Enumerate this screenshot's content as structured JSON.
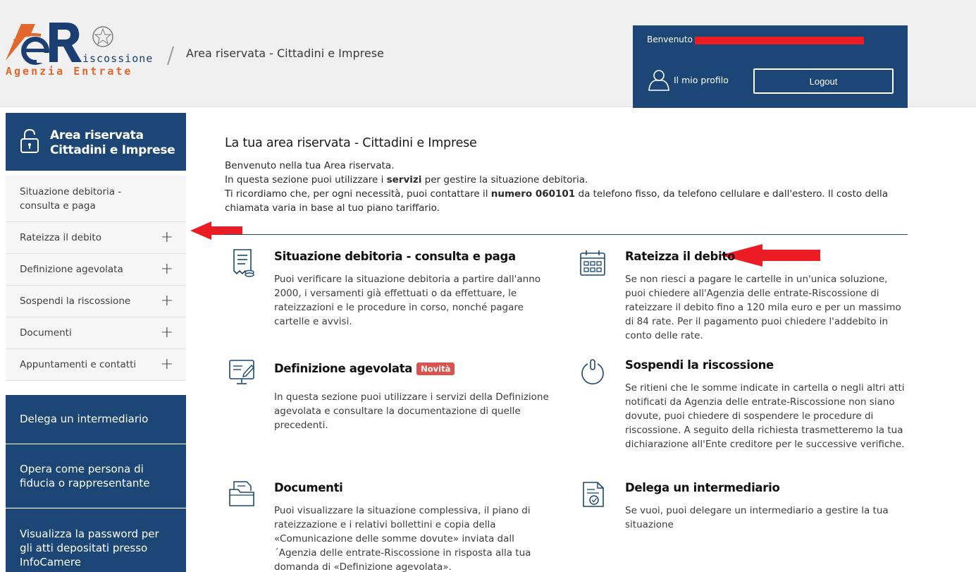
{
  "logo": {
    "brand_line1": "iscossione",
    "brand_line2": "Agenzia Entrate"
  },
  "header": {
    "title": "Area riservata - Cittadini e Imprese"
  },
  "user": {
    "welcome": "Benvenuto",
    "profile_label": "Il mio profilo",
    "logout_label": "Logout"
  },
  "sidebar": {
    "heading_line1": "Area riservata",
    "heading_line2": "Cittadini e Imprese",
    "items": [
      {
        "label": "Situazione debitoria - consulta e paga"
      },
      {
        "label": "Rateizza il debito",
        "expand": "+"
      },
      {
        "label": "Definizione agevolata",
        "expand": "+"
      },
      {
        "label": "Sospendi la riscossione",
        "expand": "+"
      },
      {
        "label": "Documenti",
        "expand": "+"
      },
      {
        "label": "Appuntamenti e contatti",
        "expand": "+"
      }
    ],
    "blocks": [
      {
        "label": "Delega un intermediario"
      },
      {
        "label": "Opera come persona di fiducia o rappresentante"
      },
      {
        "label": "Visualizza la password per gli atti depositati presso InfoCamere"
      }
    ]
  },
  "main": {
    "title": "La tua area riservata - Cittadini e Imprese",
    "intro_line1": "Benvenuto nella tua Area riservata.",
    "intro_line2_a": "In questa sezione puoi utilizzare i ",
    "intro_line2_b": "servizi",
    "intro_line2_c": " per gestire la situazione debitoria.",
    "intro_line3_a": "Ti ricordiamo che, per ogni necessità, puoi contattare il ",
    "intro_line3_b": "numero 060101",
    "intro_line3_c": " da telefono fisso, da telefono cellulare e dall'estero. Il costo della chiamata varia in base al tuo piano tariffario.",
    "cards": [
      {
        "title": "Situazione debitoria - consulta e paga",
        "icon": "receipt-icon",
        "desc": "Puoi verificare la situazione debitoria a partire dall'anno 2000, i versamenti già effettuati o da effettuare, le rateizzazioni e le procedure in corso, nonché pagare cartelle e avvisi."
      },
      {
        "title": "Rateizza il debito",
        "icon": "calendar-icon",
        "desc": "Se non riesci a pagare le cartelle in un'unica soluzione, puoi chiedere all'Agenzia delle entrate-Riscossione di rateizzare il debito fino a 120 mila euro e per un massimo di 84 rate. Per il pagamento puoi chiedere l'addebito in conto delle rate."
      },
      {
        "title": "Definizione agevolata",
        "icon": "monitor-edit-icon",
        "badge": "Novità",
        "desc": "In questa sezione puoi utilizzare i servizi della Definizione agevolata e consultare la documentazione di quelle precedenti."
      },
      {
        "title": "Sospendi la riscossione",
        "icon": "power-icon",
        "desc": "Se ritieni che le somme indicate in cartella o negli altri atti notificati da Agenzia delle entrate-Riscossione non siano dovute, puoi chiedere di sospendere le procedure di riscossione. A seguito della richiesta trasmetteremo la tua dichiarazione all'Ente creditore per le successive verifiche."
      },
      {
        "title": "Documenti",
        "icon": "folder-documents-icon",
        "desc": "Puoi visualizzare la situazione complessiva, il piano di rateizzazione e i relativi bollettini e copia della «Comunicazione delle somme dovute» inviata dall´Agenzia delle entrate-Riscossione in risposta alla tua domanda di «Definizione agevolata»."
      },
      {
        "title": "Delega un intermediario",
        "icon": "document-delegate-icon",
        "desc": "Se vuoi, puoi delegare un intermediario a gestire la tua situazione"
      }
    ]
  },
  "colors": {
    "brand_blue": "#1b4675",
    "logo_orange": "#e2672c",
    "logo_navy": "#1b3f73",
    "badge_red": "#d9534f",
    "annotation_red": "#ec1c24"
  }
}
